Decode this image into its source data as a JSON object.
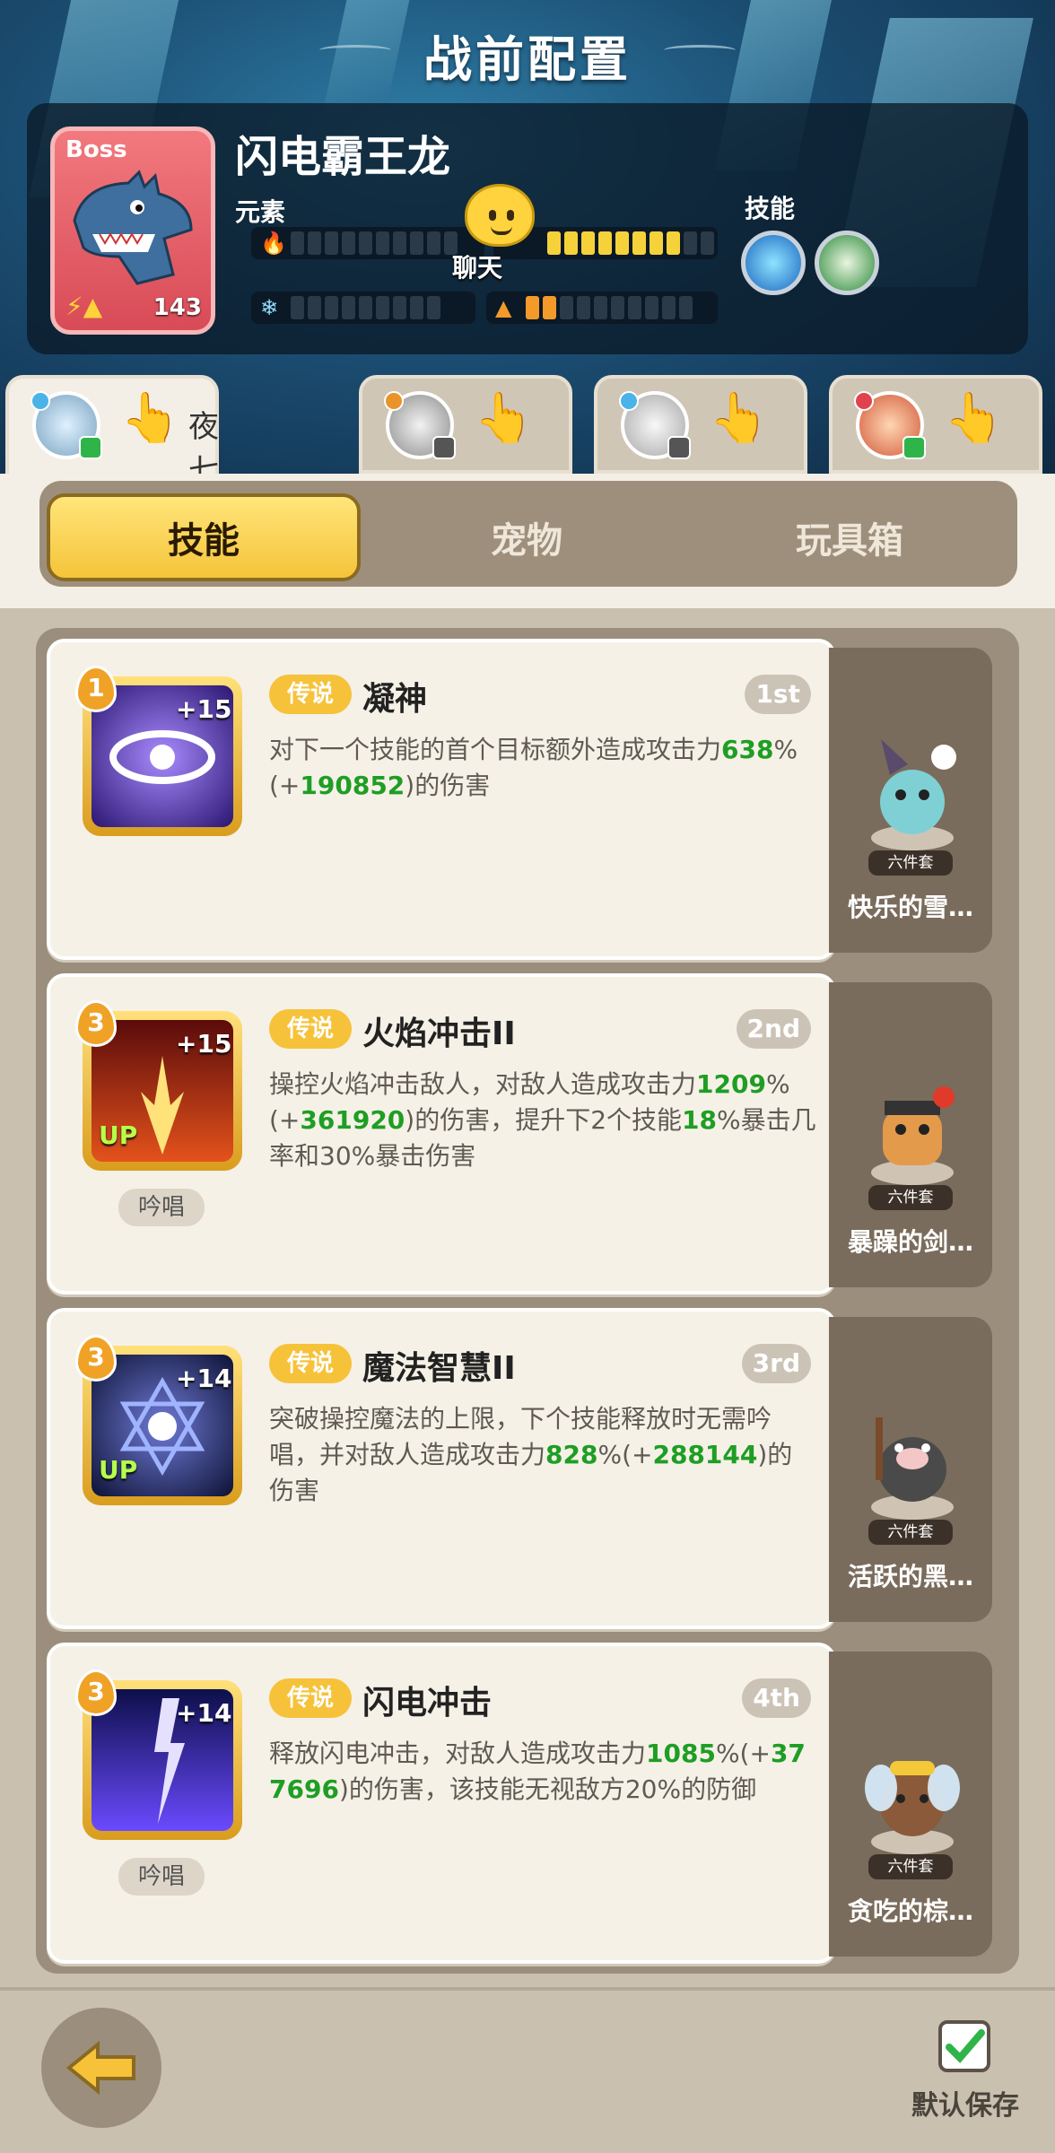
{
  "header": {
    "title": "战前配置"
  },
  "boss": {
    "tag": "Boss",
    "level": "143",
    "name": "闪电霸王龙",
    "element_label": "元素",
    "skill_label": "技能"
  },
  "chat": {
    "label": "聊天"
  },
  "players": [
    {
      "name": "夜七呀",
      "active": true
    },
    {
      "name": "",
      "active": false
    },
    {
      "name": "",
      "active": false
    },
    {
      "name": "",
      "active": false
    }
  ],
  "tabs": [
    {
      "label": "技能",
      "active": true
    },
    {
      "label": "宠物",
      "active": false
    },
    {
      "label": "玩具箱",
      "active": false
    }
  ],
  "skills": [
    {
      "level": "1",
      "plus": "+15",
      "up": "",
      "chant": "",
      "rarity": "传说",
      "name": "凝神",
      "order": "1st",
      "desc_parts": [
        {
          "t": "对下一个技能的首个目标额外造成攻击力",
          "g": false
        },
        {
          "t": "638",
          "g": true
        },
        {
          "t": "%(+",
          "g": false
        },
        {
          "t": "190852",
          "g": true
        },
        {
          "t": ")的伤害",
          "g": false
        }
      ],
      "pet_set": "六件套",
      "pet_name": "快乐的雪…"
    },
    {
      "level": "3",
      "plus": "+15",
      "up": "UP",
      "chant": "吟唱",
      "rarity": "传说",
      "name": "火焰冲击II",
      "order": "2nd",
      "desc_parts": [
        {
          "t": "操控火焰冲击敌人，对敌人造成攻击力",
          "g": false
        },
        {
          "t": "1209",
          "g": true
        },
        {
          "t": "%(+",
          "g": false
        },
        {
          "t": "361920",
          "g": true
        },
        {
          "t": ")的伤害，提升下2个技能",
          "g": false
        },
        {
          "t": "18",
          "g": true
        },
        {
          "t": "%暴击几率和30%暴击伤害",
          "g": false
        }
      ],
      "pet_set": "六件套",
      "pet_name": "暴躁的剑…"
    },
    {
      "level": "3",
      "plus": "+14",
      "up": "UP",
      "chant": "",
      "rarity": "传说",
      "name": "魔法智慧II",
      "order": "3rd",
      "desc_parts": [
        {
          "t": "突破操控魔法的上限，下个技能释放时无需吟唱，并对敌人造成攻击力",
          "g": false
        },
        {
          "t": "828",
          "g": true
        },
        {
          "t": "%(+",
          "g": false
        },
        {
          "t": "288144",
          "g": true
        },
        {
          "t": ")的伤害",
          "g": false
        }
      ],
      "pet_set": "六件套",
      "pet_name": "活跃的黑…"
    },
    {
      "level": "3",
      "plus": "+14",
      "up": "",
      "chant": "吟唱",
      "rarity": "传说",
      "name": "闪电冲击",
      "order": "4th",
      "desc_parts": [
        {
          "t": "释放闪电冲击，对敌人造成攻击力",
          "g": false
        },
        {
          "t": "1085",
          "g": true
        },
        {
          "t": "%(+",
          "g": false
        },
        {
          "t": "377696",
          "g": true
        },
        {
          "t": ")的伤害，该技能无视敌方20%的防御",
          "g": false
        }
      ],
      "pet_set": "六件套",
      "pet_name": "贪吃的棕…"
    }
  ],
  "footer": {
    "save_label": "默认保存"
  },
  "colors": {
    "accent_gold": "#f5c43a",
    "highlight_green": "#1e9e24",
    "boss_red": "#d84b57"
  }
}
